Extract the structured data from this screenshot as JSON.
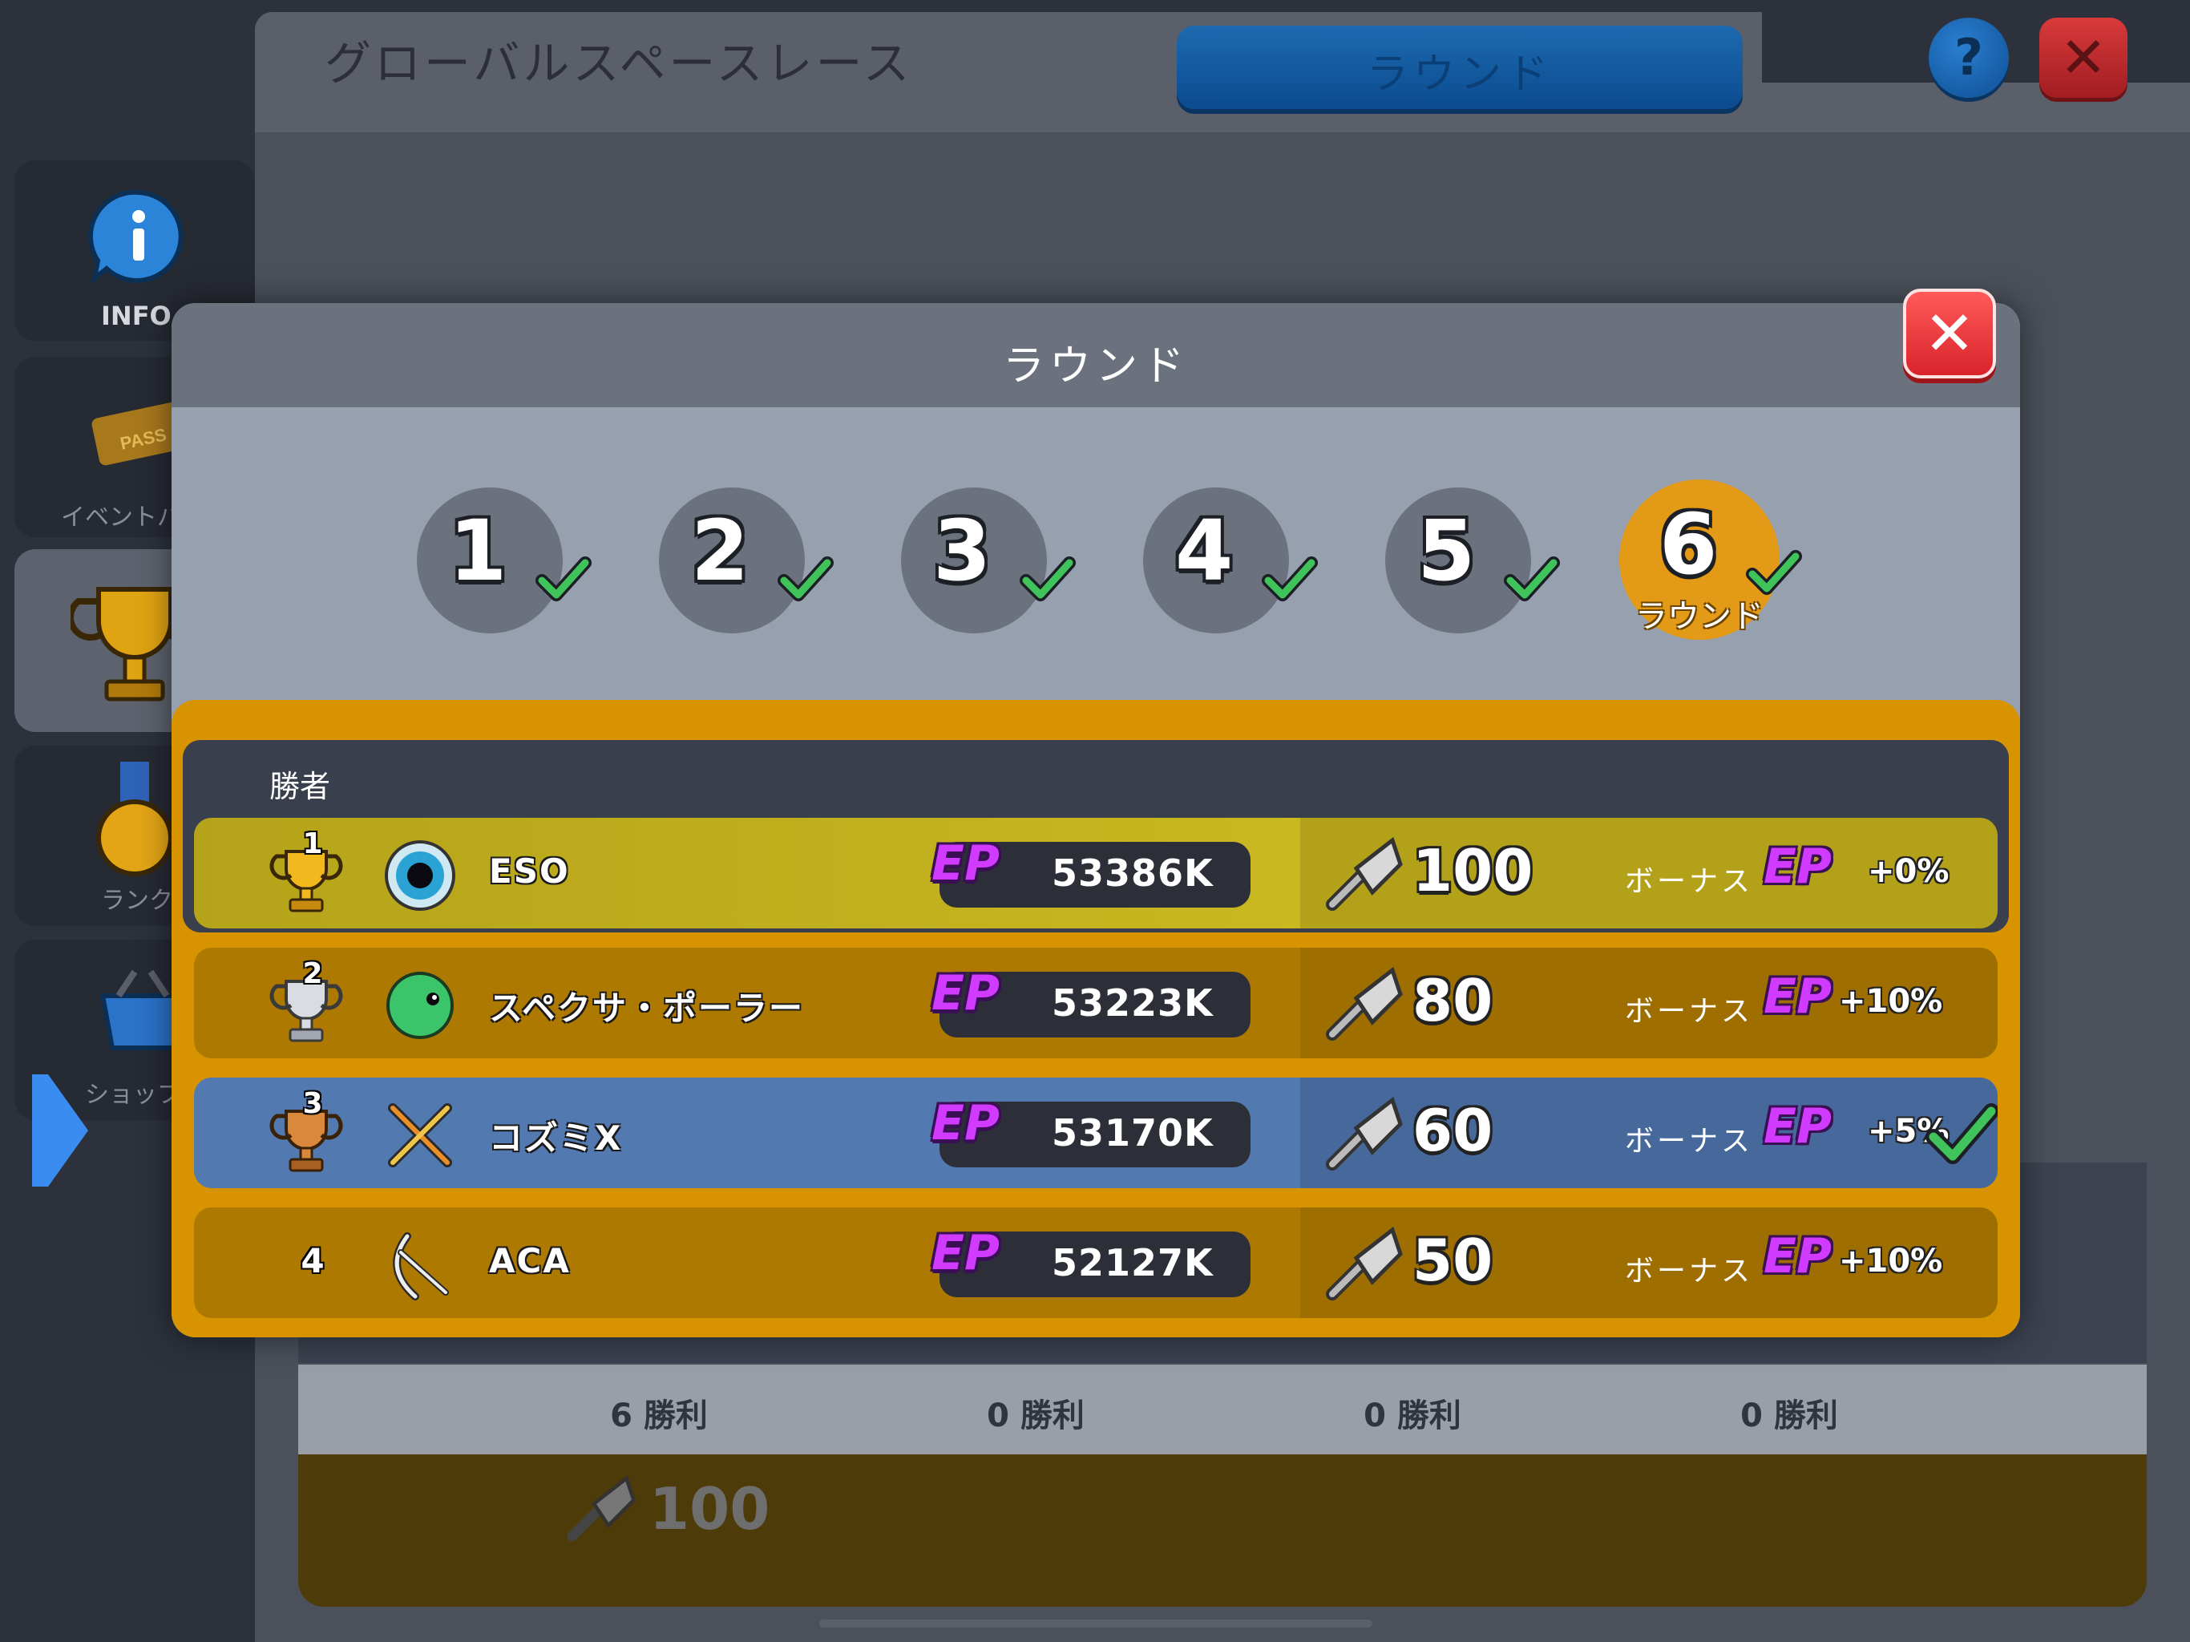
{
  "header": {
    "title": "グローバルスペースレース",
    "tab_label": "ラウンド",
    "help_label": "?",
    "close_label": "✕"
  },
  "sidebar": {
    "items": [
      {
        "label": "INFO",
        "icon": "info-icon"
      },
      {
        "label": "イベントパ",
        "icon": "pass-ticket-icon"
      },
      {
        "label": "",
        "icon": "trophy-icon"
      },
      {
        "label": "ランク",
        "icon": "medal-icon"
      },
      {
        "label": "ショップ",
        "icon": "shop-basket-icon"
      }
    ]
  },
  "background": {
    "wins": [
      "6 勝利",
      "0 勝利",
      "0 勝利",
      "0 勝利"
    ],
    "reward_value": "100"
  },
  "modal": {
    "title": "ラウンド",
    "close_label": "✕",
    "rounds": [
      {
        "number": "1",
        "completed": true
      },
      {
        "number": "2",
        "completed": true
      },
      {
        "number": "3",
        "completed": true
      },
      {
        "number": "4",
        "completed": true
      },
      {
        "number": "5",
        "completed": true
      },
      {
        "number": "6",
        "completed": true,
        "current": true,
        "label": "ラウンド"
      }
    ],
    "winner_label": "勝者",
    "ep_label": "EP",
    "bonus_label": "ボーナス",
    "rows": [
      {
        "rank": "1",
        "name": "ESO",
        "ep": "53386K",
        "keys": "100",
        "bonus": "+0%",
        "avatar": "blackhole-icon",
        "highlight": "winner"
      },
      {
        "rank": "2",
        "name": "スペクサ・ポーラー",
        "ep": "53223K",
        "keys": "80",
        "bonus": "+10%",
        "avatar": "green-creature-icon",
        "highlight": "none"
      },
      {
        "rank": "3",
        "name": "コズミX",
        "ep": "53170K",
        "keys": "60",
        "bonus": "+5%",
        "avatar": "crossed-swords-icon",
        "highlight": "self"
      },
      {
        "rank": "4",
        "name": "ACA",
        "ep": "52127K",
        "keys": "50",
        "bonus": "+10%",
        "avatar": "bow-icon",
        "highlight": "none"
      }
    ]
  },
  "colors": {
    "accent_orange": "#d89300",
    "winner_row": "#b4a41a",
    "self_row": "#5279b0",
    "ep_purple": "#d13bff",
    "check_green": "#3fc35a"
  }
}
